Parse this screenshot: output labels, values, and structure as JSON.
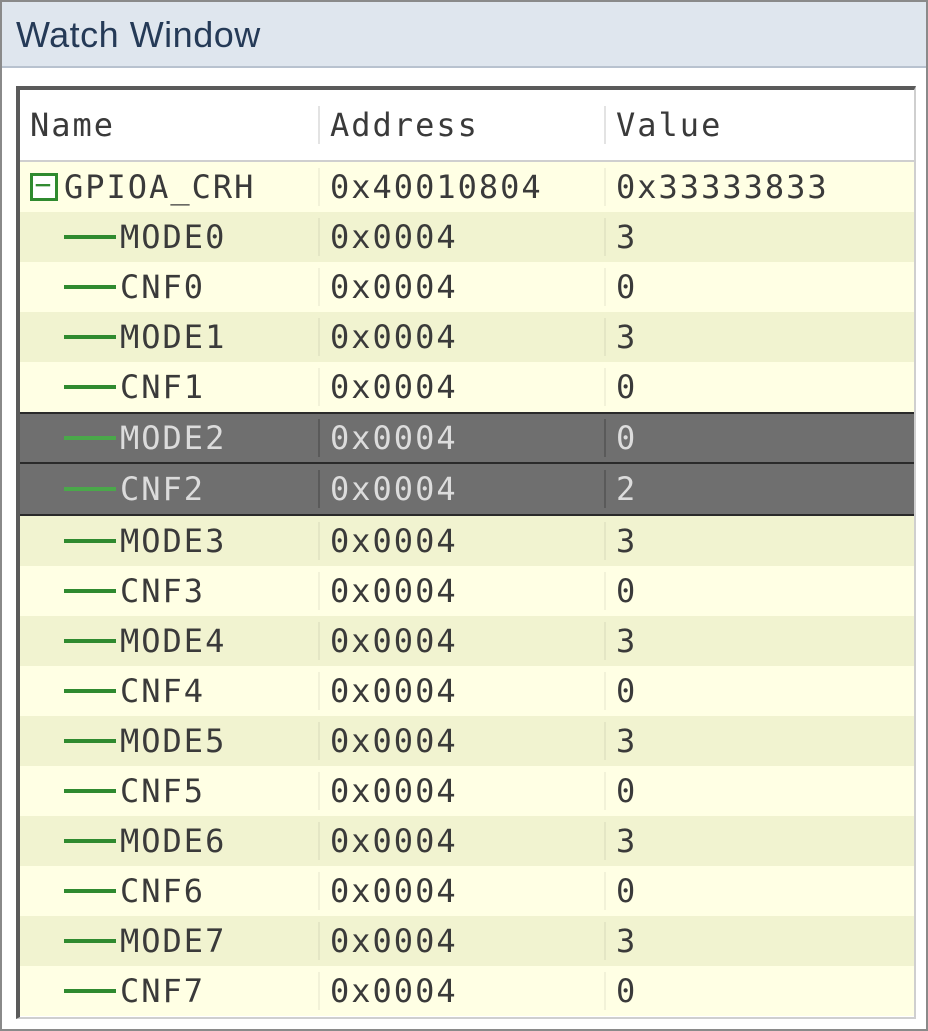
{
  "window": {
    "title": "Watch Window"
  },
  "columns": {
    "name": "Name",
    "address": "Address",
    "value": "Value"
  },
  "root": {
    "name": "GPIOA_CRH",
    "address": "0x40010804",
    "value": "0x33333833",
    "expanded": true,
    "expand_glyph": "−"
  },
  "children": [
    {
      "name": "MODE0",
      "address": "0x0004",
      "value": "3",
      "selected": false
    },
    {
      "name": "CNF0",
      "address": "0x0004",
      "value": "0",
      "selected": false
    },
    {
      "name": "MODE1",
      "address": "0x0004",
      "value": "3",
      "selected": false
    },
    {
      "name": "CNF1",
      "address": "0x0004",
      "value": "0",
      "selected": false
    },
    {
      "name": "MODE2",
      "address": "0x0004",
      "value": "0",
      "selected": true
    },
    {
      "name": "CNF2",
      "address": "0x0004",
      "value": "2",
      "selected": true
    },
    {
      "name": "MODE3",
      "address": "0x0004",
      "value": "3",
      "selected": false
    },
    {
      "name": "CNF3",
      "address": "0x0004",
      "value": "0",
      "selected": false
    },
    {
      "name": "MODE4",
      "address": "0x0004",
      "value": "3",
      "selected": false
    },
    {
      "name": "CNF4",
      "address": "0x0004",
      "value": "0",
      "selected": false
    },
    {
      "name": "MODE5",
      "address": "0x0004",
      "value": "3",
      "selected": false
    },
    {
      "name": "CNF5",
      "address": "0x0004",
      "value": "0",
      "selected": false
    },
    {
      "name": "MODE6",
      "address": "0x0004",
      "value": "3",
      "selected": false
    },
    {
      "name": "CNF6",
      "address": "0x0004",
      "value": "0",
      "selected": false
    },
    {
      "name": "MODE7",
      "address": "0x0004",
      "value": "3",
      "selected": false
    },
    {
      "name": "CNF7",
      "address": "0x0004",
      "value": "0",
      "selected": false
    }
  ]
}
